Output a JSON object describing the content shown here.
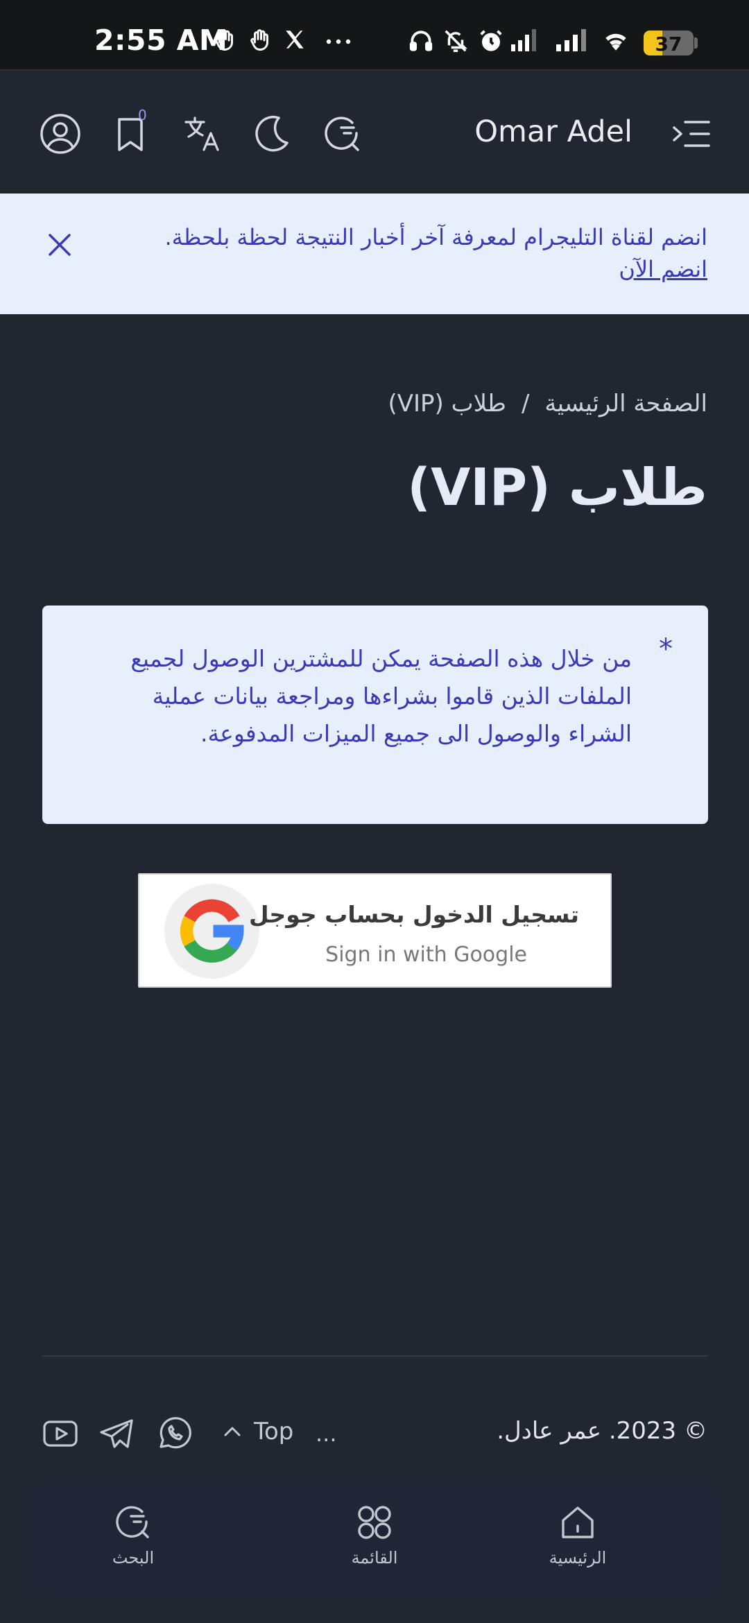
{
  "status_bar": {
    "time": "2:55 AM",
    "notification_icons": [
      "wave-hand-icon",
      "wave-hand-icon",
      "x-logo-icon",
      "more-dots-icon"
    ],
    "system_icons": [
      "headphones-icon",
      "bell-muted-icon",
      "alarm-icon",
      "signal-icon",
      "signal-icon",
      "wifi-icon"
    ],
    "battery_level": "37",
    "battery_fraction": 0.37,
    "battery_color": "#f3c51a"
  },
  "header": {
    "brand": "Omar Adel",
    "bookmark_count": "0",
    "icons": [
      "account-icon",
      "bookmark-icon",
      "translate-icon",
      "dark-mode-icon",
      "search-icon",
      "menu-icon"
    ]
  },
  "banner": {
    "text": "انضم لقناة التليجرام لمعرفة آخر أخبار النتيجة لحظة بلحظة.",
    "link": "انضم الآن"
  },
  "breadcrumb": {
    "home": "الصفحة الرئيسية",
    "separator": "/",
    "current": "طلاب (VIP)"
  },
  "page": {
    "title": "طلاب (VIP)"
  },
  "info_box": {
    "marker": "*",
    "text": "من خلال هذه الصفحة يمكن للمشترين الوصول لجميع الملفات الذين قاموا بشراءها ومراجعة بيانات عملية الشراء والوصول الى جميع الميزات المدفوعة."
  },
  "google_button": {
    "label_ar": "تسجيل الدخول بحساب جوجل",
    "label_en": "Sign in with Google"
  },
  "footer": {
    "copyright": "© 2023. عمر عادل.",
    "dots": "...",
    "top_label": "Top"
  },
  "bottom_nav": {
    "items": [
      {
        "label": "الرئيسية",
        "icon": "home-icon"
      },
      {
        "label": "القائمة",
        "icon": "grid-icon"
      },
      {
        "label": "البحث",
        "icon": "search-icon"
      }
    ]
  },
  "colors": {
    "background": "#222630",
    "banner_bg": "#e7eefc",
    "accent_text": "#3a3ab8",
    "bottom_nav_bg": "#1f2636"
  }
}
